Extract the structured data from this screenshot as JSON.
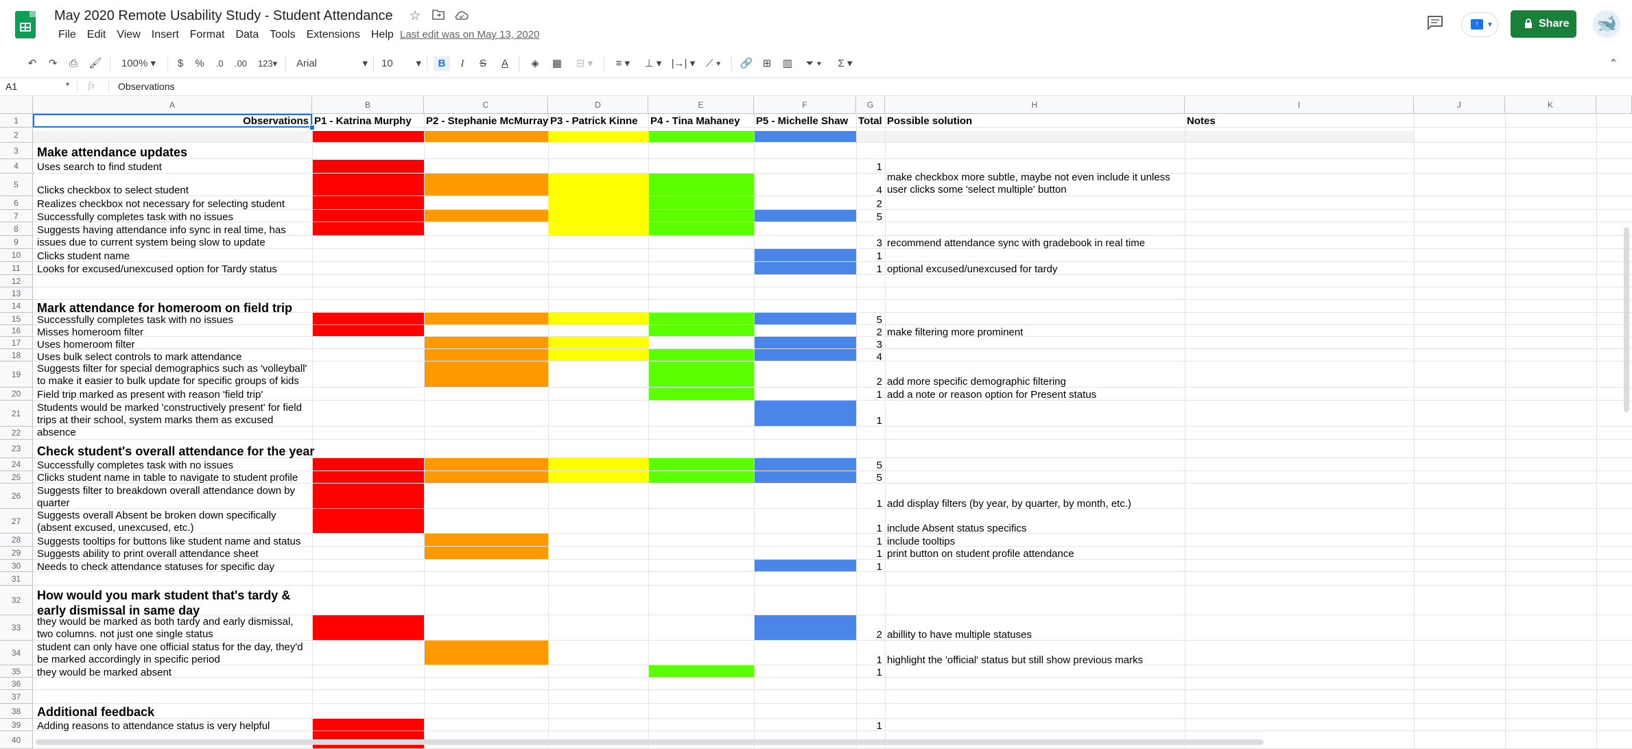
{
  "doc": {
    "title": "May 2020 Remote Usability Study - Student Attendance",
    "last_edit": "Last edit was on May 13, 2020",
    "share_label": "Share",
    "menu": [
      "File",
      "Edit",
      "View",
      "Insert",
      "Format",
      "Data",
      "Tools",
      "Extensions",
      "Help"
    ]
  },
  "toolbar": {
    "zoom": "100%",
    "currency": "$",
    "percent": "%",
    "dec_decrease": ".0",
    "dec_increase": ".00",
    "more_formats": "123",
    "font": "Arial",
    "font_size": "10"
  },
  "formula_bar": {
    "cell_ref": "A1",
    "fx": "fx",
    "value": "Observations"
  },
  "columns": [
    "A",
    "B",
    "C",
    "D",
    "E",
    "F",
    "G",
    "H",
    "I",
    "J",
    "K"
  ],
  "header_row": {
    "observations": "Observations",
    "p1": "P1 - Katrina Murphy",
    "p2": "P2 - Stephanie McMurray",
    "p3": "P3 - Patrick Kinne",
    "p4": "P4 - Tina Mahaney",
    "p5": "P5 - Michelle Shaw",
    "total": "Total",
    "solution": "Possible solution",
    "notes": "Notes"
  },
  "colors": {
    "red": "#ff0000",
    "orange": "#ff9900",
    "yellow": "#ffff00",
    "green": "#5cff00",
    "blue": "#4a86e8",
    "header_bg": "#f8f9fa",
    "accent_green": "#188038"
  },
  "sections": {
    "s1": "Make attendance updates",
    "s2": "Mark attendance for homeroom on field trip",
    "s3": "Check student's overall attendance for the year",
    "s4": "How would you mark student that's tardy & early dismissal in same day",
    "s5": "Additional feedback"
  },
  "rows": {
    "r4": {
      "obs": "Uses search to find student",
      "total": "1",
      "sol": ""
    },
    "r5": {
      "obs": "Clicks checkbox to select student",
      "total": "4",
      "sol": "make checkbox more subtle, maybe not even include it unless user clicks some 'select multiple' button"
    },
    "r6": {
      "obs": "Realizes checkbox not necessary for selecting student",
      "total": "2",
      "sol": ""
    },
    "r7": {
      "obs": "Successfully completes task with no issues",
      "total": "5",
      "sol": ""
    },
    "r8": {
      "obs": "Suggests having attendance info sync in real time, has issues due to current system being slow to update",
      "total": "3",
      "sol": "recommend attendance sync with gradebook in real time"
    },
    "r9": {
      "obs": "Clicks student name",
      "total": "1",
      "sol": ""
    },
    "r10": {
      "obs": "Looks for excused/unexcused option for Tardy status",
      "total": "1",
      "sol": "optional excused/unexcused for tardy"
    },
    "r14": {
      "obs": "Successfully completes task with no issues",
      "total": "5",
      "sol": ""
    },
    "r15": {
      "obs": "Misses homeroom filter",
      "total": "2",
      "sol": "make filtering more prominent"
    },
    "r16": {
      "obs": "Uses homeroom filter",
      "total": "3",
      "sol": ""
    },
    "r17": {
      "obs": "Uses bulk select controls to mark attendance",
      "total": "4",
      "sol": ""
    },
    "r18": {
      "obs": "Suggests filter for special demographics such as 'volleyball' to make it easier to bulk update for specific groups of kids",
      "total": "2",
      "sol": "add more specific demographic filtering"
    },
    "r19": {
      "obs": "Field trip marked as present with reason 'field trip'",
      "total": "1",
      "sol": "add a note or reason option for Present status"
    },
    "r20": {
      "obs": "Students would be marked 'constructively present' for field trips at their school, system marks them as excused absence",
      "total": "1",
      "sol": ""
    },
    "r23": {
      "obs": "Successfully completes task with no issues",
      "total": "5",
      "sol": ""
    },
    "r24": {
      "obs": "Clicks student name in table to navigate to student profile",
      "total": "5",
      "sol": ""
    },
    "r25": {
      "obs": "Suggests filter to breakdown overall attendance down by quarter",
      "total": "1",
      "sol": "add display filters (by year, by quarter, by month, etc.)"
    },
    "r26": {
      "obs": "Suggests overall Absent be broken down specifically (absent excused, unexcused, etc.)",
      "total": "1",
      "sol": "include Absent status specifics"
    },
    "r27": {
      "obs": "Suggests tooltips for buttons like student name and status",
      "total": "1",
      "sol": "include tooltips"
    },
    "r28": {
      "obs": "Suggests ability to print overall attendance sheet",
      "total": "1",
      "sol": "print button on student profile attendance"
    },
    "r29": {
      "obs": "Needs to check attendance statuses for specific day",
      "total": "1",
      "sol": ""
    },
    "r32": {
      "obs": "they would be marked as both tardy and early dismissal, two columns. not just one single status",
      "total": "2",
      "sol": "abillity to have multiple statuses"
    },
    "r33": {
      "obs": "student can only have one official status for the day, they'd be marked accordingly in specific period",
      "total": "1",
      "sol": "highlight the 'official' status but still show previous marks"
    },
    "r34": {
      "obs": "they would be marked absent",
      "total": "1",
      "sol": ""
    },
    "r38": {
      "obs": "Adding reasons to attendance status is very helpful",
      "total": "1",
      "sol": ""
    },
    "r39": {
      "obs": "",
      "total": "",
      "sol": ""
    }
  }
}
